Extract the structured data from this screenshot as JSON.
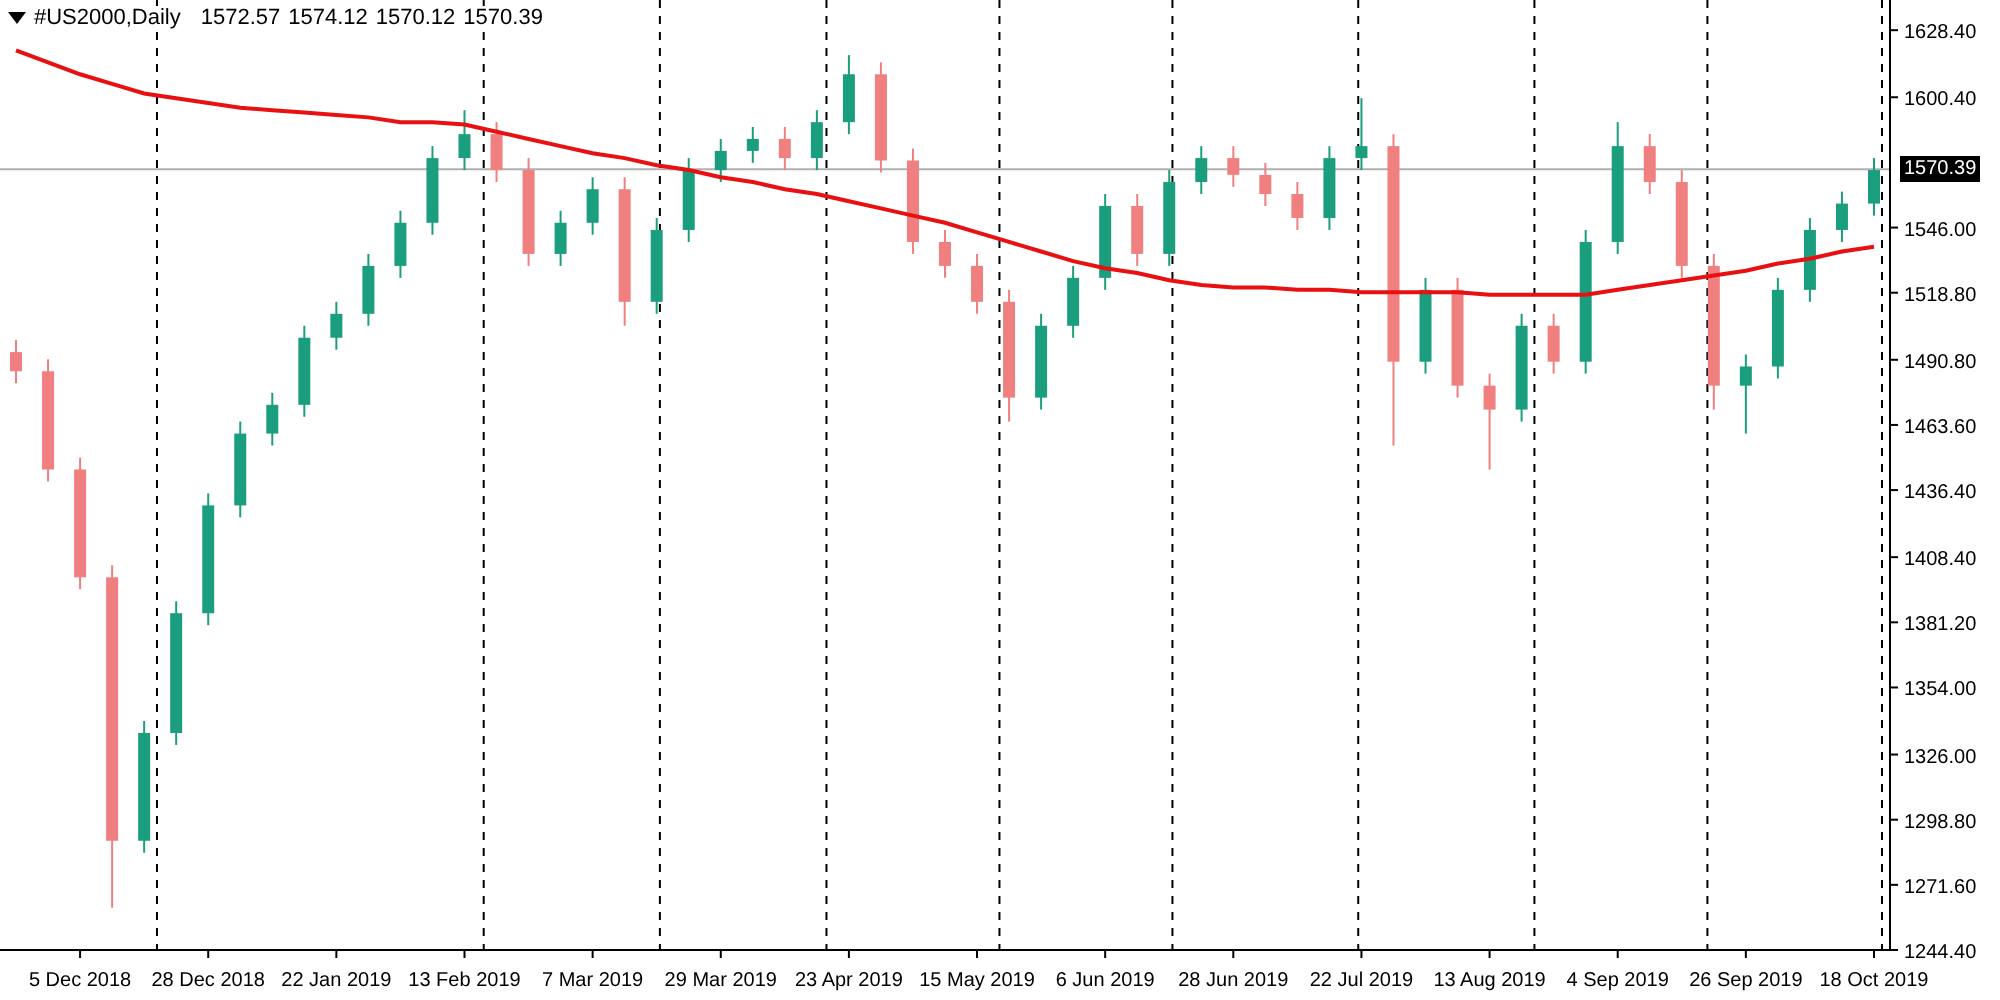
{
  "header": {
    "symbol": "#US2000,Daily",
    "ohlc": [
      "1572.57",
      "1574.12",
      "1570.12",
      "1570.39"
    ]
  },
  "chart": {
    "chart_data": {
      "type": "candlestick",
      "grid": true,
      "ylim": [
        1244.4,
        1641
      ],
      "categories": [
        null,
        null,
        "5 Dec 2018",
        null,
        null,
        null,
        "28 Dec 2018",
        null,
        null,
        null,
        "22 Jan 2019",
        null,
        null,
        null,
        "13 Feb 2019",
        null,
        null,
        null,
        "7 Mar 2019",
        null,
        null,
        null,
        "29 Mar 2019",
        null,
        null,
        null,
        "23 Apr 2019",
        null,
        null,
        null,
        "15 May 2019",
        null,
        null,
        null,
        "6 Jun 2019",
        null,
        null,
        null,
        "28 Jun 2019",
        null,
        null,
        null,
        "22 Jul 2019",
        null,
        null,
        null,
        "13 Aug 2019",
        null,
        null,
        null,
        "4 Sep 2019",
        null,
        null,
        null,
        "26 Sep 2019",
        null,
        null,
        null,
        "18 Oct 2019"
      ],
      "ohlc": [
        [
          1494,
          1499,
          1481,
          1486
        ],
        [
          1486,
          1491,
          1440,
          1445
        ],
        [
          1445,
          1450,
          1395,
          1400
        ],
        [
          1400,
          1405,
          1262,
          1290
        ],
        [
          1290,
          1340,
          1285,
          1335
        ],
        [
          1335,
          1390,
          1330,
          1385
        ],
        [
          1385,
          1435,
          1380,
          1430
        ],
        [
          1430,
          1465,
          1425,
          1460
        ],
        [
          1460,
          1477,
          1455,
          1472
        ],
        [
          1472,
          1505,
          1467,
          1500
        ],
        [
          1500,
          1515,
          1495,
          1510
        ],
        [
          1510,
          1535,
          1505,
          1530
        ],
        [
          1530,
          1553,
          1525,
          1548
        ],
        [
          1548,
          1580,
          1543,
          1575
        ],
        [
          1575,
          1595,
          1570,
          1585
        ],
        [
          1585,
          1590,
          1565,
          1570
        ],
        [
          1570,
          1575,
          1530,
          1535
        ],
        [
          1535,
          1553,
          1530,
          1548
        ],
        [
          1548,
          1567,
          1543,
          1562
        ],
        [
          1562,
          1567,
          1505,
          1515
        ],
        [
          1515,
          1550,
          1510,
          1545
        ],
        [
          1545,
          1575,
          1540,
          1570
        ],
        [
          1570,
          1583,
          1565,
          1578
        ],
        [
          1578,
          1588,
          1573,
          1583
        ],
        [
          1583,
          1588,
          1570,
          1575
        ],
        [
          1575,
          1595,
          1570,
          1590
        ],
        [
          1590,
          1618,
          1585,
          1610
        ],
        [
          1610,
          1615,
          1569,
          1574
        ],
        [
          1574,
          1579,
          1535,
          1540
        ],
        [
          1540,
          1545,
          1525,
          1530
        ],
        [
          1530,
          1535,
          1510,
          1515
        ],
        [
          1515,
          1520,
          1465,
          1475
        ],
        [
          1475,
          1510,
          1470,
          1505
        ],
        [
          1505,
          1530,
          1500,
          1525
        ],
        [
          1525,
          1560,
          1520,
          1555
        ],
        [
          1555,
          1560,
          1530,
          1535
        ],
        [
          1535,
          1570,
          1530,
          1565
        ],
        [
          1565,
          1580,
          1560,
          1575
        ],
        [
          1575,
          1580,
          1563,
          1568
        ],
        [
          1568,
          1573,
          1555,
          1560
        ],
        [
          1560,
          1565,
          1545,
          1550
        ],
        [
          1550,
          1580,
          1545,
          1575
        ],
        [
          1575,
          1600,
          1570,
          1580
        ],
        [
          1580,
          1585,
          1455,
          1490
        ],
        [
          1490,
          1525,
          1485,
          1520
        ],
        [
          1520,
          1525,
          1475,
          1480
        ],
        [
          1480,
          1485,
          1445,
          1470
        ],
        [
          1470,
          1510,
          1465,
          1505
        ],
        [
          1505,
          1510,
          1485,
          1490
        ],
        [
          1490,
          1545,
          1485,
          1540
        ],
        [
          1540,
          1590,
          1535,
          1580
        ],
        [
          1580,
          1585,
          1560,
          1565
        ],
        [
          1565,
          1570,
          1525,
          1530
        ],
        [
          1530,
          1535,
          1470,
          1480
        ],
        [
          1480,
          1493,
          1460,
          1488
        ],
        [
          1488,
          1525,
          1483,
          1520
        ],
        [
          1520,
          1550,
          1515,
          1545
        ],
        [
          1545,
          1561,
          1540,
          1556
        ],
        [
          1556,
          1575,
          1551,
          1570
        ]
      ],
      "series": [
        {
          "type": "line",
          "color": "#e81010",
          "values": [
            1620,
            1615,
            1610,
            1606,
            1602,
            1600,
            1598,
            1596,
            1595,
            1594,
            1593,
            1592,
            1590,
            1590,
            1589,
            1586,
            1583,
            1580,
            1577,
            1575,
            1572,
            1570,
            1567,
            1565,
            1562,
            1560,
            1557,
            1554,
            1551,
            1548,
            1544,
            1540,
            1536,
            1532,
            1529,
            1527,
            1524,
            1522,
            1521,
            1521,
            1520,
            1520,
            1519,
            1519,
            1519,
            1519,
            1518,
            1518,
            1518,
            1518,
            1520,
            1522,
            1524,
            1526,
            1528,
            1531,
            1533,
            1536,
            1538
          ]
        }
      ],
      "yticks": [
        {
          "value": 1628.4,
          "label": "1628.40"
        },
        {
          "value": 1600.4,
          "label": "1600.40"
        },
        {
          "value": 1546,
          "label": "1546.00"
        },
        {
          "value": 1518.8,
          "label": "1518.80"
        },
        {
          "value": 1490.8,
          "label": "1490.80"
        },
        {
          "value": 1463.6,
          "label": "1463.60"
        },
        {
          "value": 1436.4,
          "label": "1436.40"
        },
        {
          "value": 1408.4,
          "label": "1408.40"
        },
        {
          "value": 1381.2,
          "label": "1381.20"
        },
        {
          "value": 1354,
          "label": "1354.00"
        },
        {
          "value": 1326,
          "label": "1326.00"
        },
        {
          "value": 1298.8,
          "label": "1298.80"
        },
        {
          "value": 1271.6,
          "label": "1271.60"
        },
        {
          "value": 1244.4,
          "label": "1244.40"
        }
      ],
      "ref_lines": [
        {
          "axis": "y",
          "value": 1570.39,
          "label": "1570.39"
        }
      ]
    }
  }
}
